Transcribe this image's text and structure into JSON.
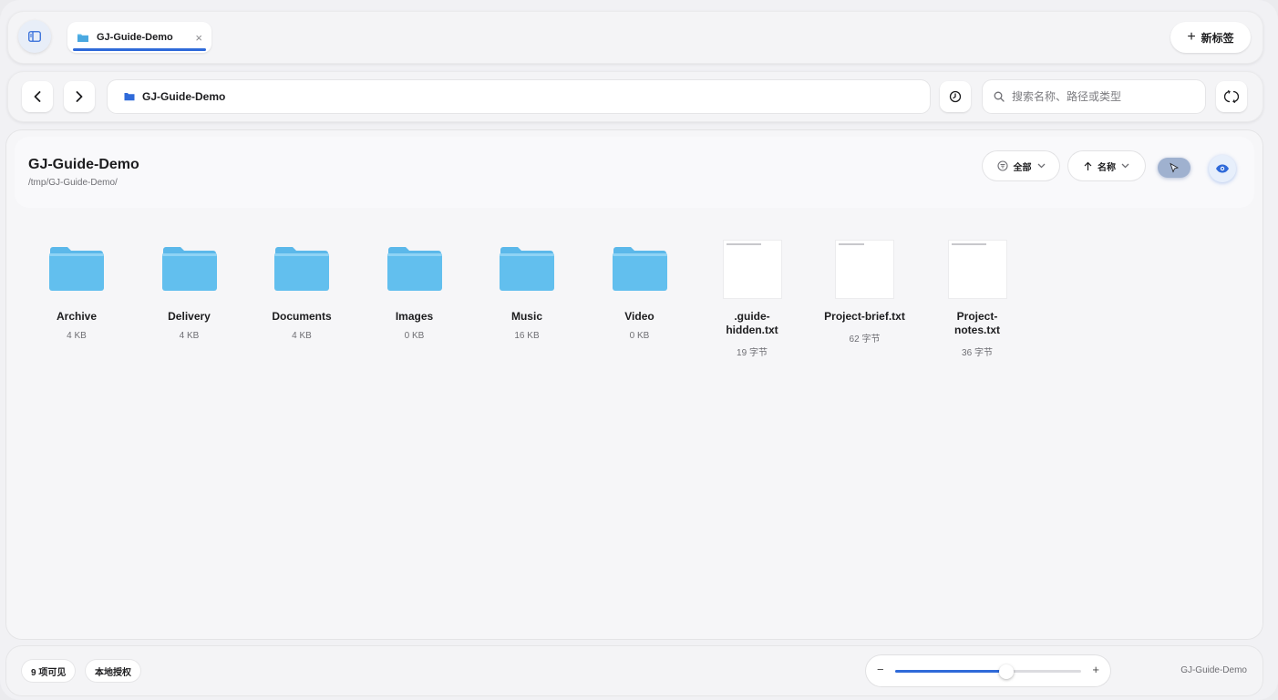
{
  "tabbar": {
    "tab_label": "GJ-Guide-Demo",
    "close_glyph": "×",
    "new_tab_label": "新标签",
    "icons": {
      "sidebar": "sidebar-icon",
      "tab": "folder-icon",
      "new_tab": "plus-icon"
    }
  },
  "addressbar": {
    "path": "GJ-Guide-Demo",
    "search_placeholder": "搜索名称、路径或类型",
    "icons": {
      "back": "chevron-left-icon",
      "forward": "chevron-right-icon",
      "history": "clock-icon",
      "search": "search-icon",
      "sync": "sync-icon"
    }
  },
  "main": {
    "title": "GJ-Guide-Demo",
    "path": "/tmp/GJ-Guide-Demo/",
    "filter_label": "全部",
    "sort_label": "名称",
    "items": [
      {
        "name": "Archive",
        "size": "4 KB",
        "kind": "folder"
      },
      {
        "name": "Delivery",
        "size": "4 KB",
        "kind": "folder"
      },
      {
        "name": "Documents",
        "size": "4 KB",
        "kind": "folder"
      },
      {
        "name": "Images",
        "size": "0 KB",
        "kind": "folder"
      },
      {
        "name": "Music",
        "size": "16 KB",
        "kind": "folder"
      },
      {
        "name": "Video",
        "size": "0 KB",
        "kind": "folder"
      },
      {
        "name": ".guide-\nhidden.txt",
        "size": "19 字节",
        "kind": "text"
      },
      {
        "name": "Project-brief.txt",
        "size": "62 字节",
        "kind": "text"
      },
      {
        "name": "Project-\nnotes.txt",
        "size": "36 字节",
        "kind": "text"
      }
    ]
  },
  "statusbar": {
    "item_count": "9 项可见",
    "auth": "本地授权",
    "zoom_minus": "−",
    "zoom_plus": "+",
    "zoom_level": 0.6,
    "folder_name": "GJ-Guide-Demo"
  },
  "colors": {
    "accent": "#2f6ad9",
    "folder": "#5bb8ea"
  }
}
